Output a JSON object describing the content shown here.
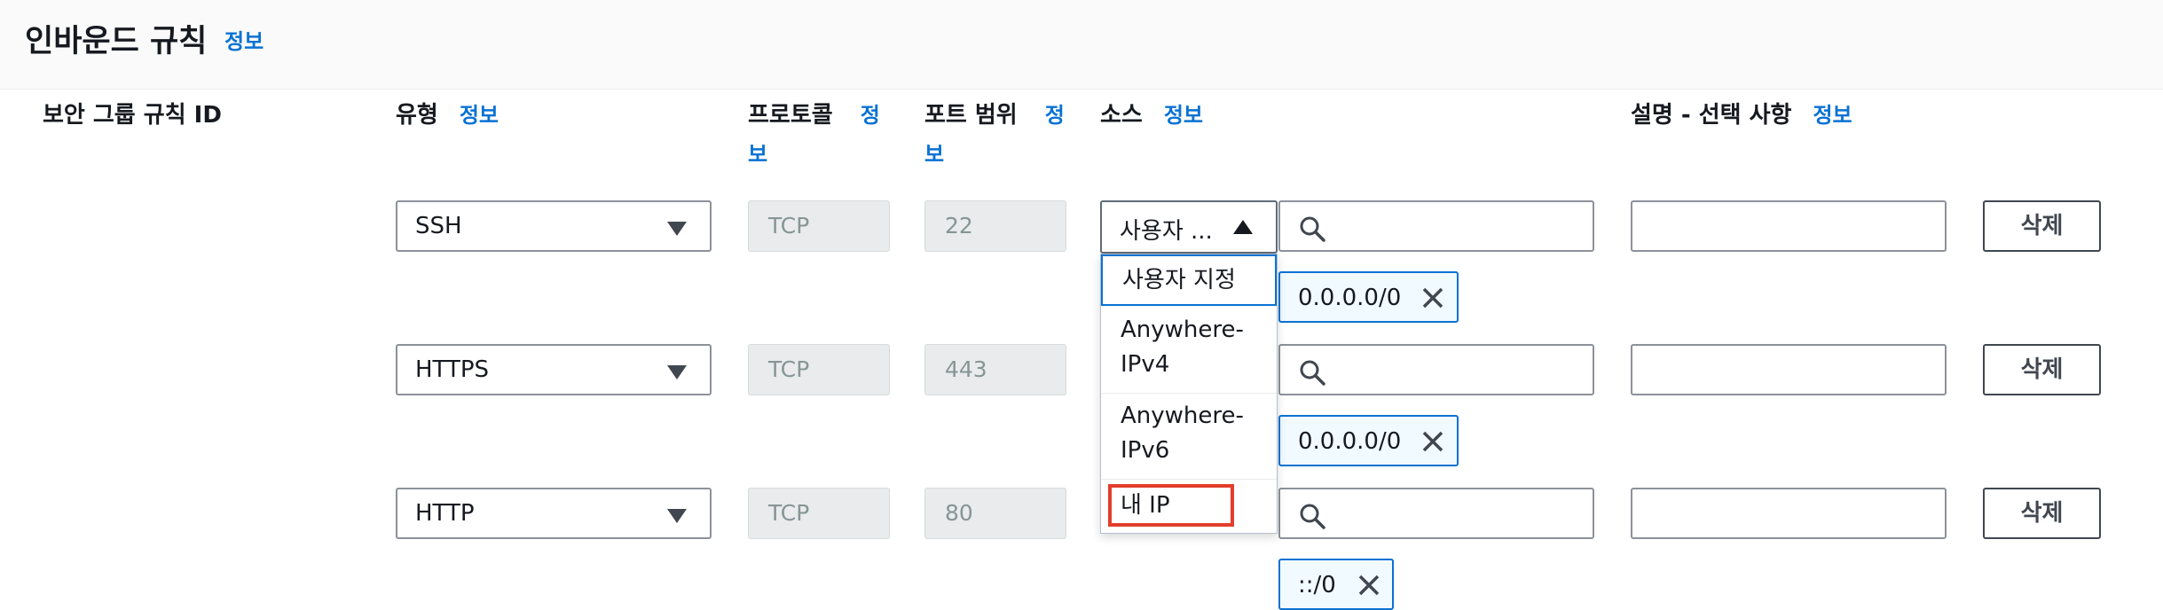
{
  "header": {
    "title": "인바운드 규칙",
    "info": "정보"
  },
  "columns": {
    "rule_id": "보안 그룹 규칙 ID",
    "type": "유형",
    "type_info": "정보",
    "protocol_line1": "프로토콜",
    "protocol_info_a": "정",
    "protocol_info_b": "보",
    "port_line1": "포트 범위",
    "port_info_a": "정",
    "port_info_b": "보",
    "source": "소스",
    "source_info": "정보",
    "description": "설명 - 선택 사항",
    "description_info": "정보"
  },
  "rows": [
    {
      "type": "SSH",
      "protocol": "TCP",
      "port": "22",
      "delete": "삭제",
      "token": "0.0.0.0/0"
    },
    {
      "type": "HTTPS",
      "protocol": "TCP",
      "port": "443",
      "delete": "삭제",
      "token": "0.0.0.0/0"
    },
    {
      "type": "HTTP",
      "protocol": "TCP",
      "port": "80",
      "delete": "삭제",
      "token": "::/0"
    }
  ],
  "source_select": {
    "value": "사용자 ..."
  },
  "source_options": [
    "사용자 지정",
    "Anywhere-IPv4",
    "Anywhere-IPv6",
    "내 IP"
  ],
  "colors": {
    "accent": "#0972d3",
    "highlight": "#e23e2b",
    "header_bg": "#fafafa"
  }
}
